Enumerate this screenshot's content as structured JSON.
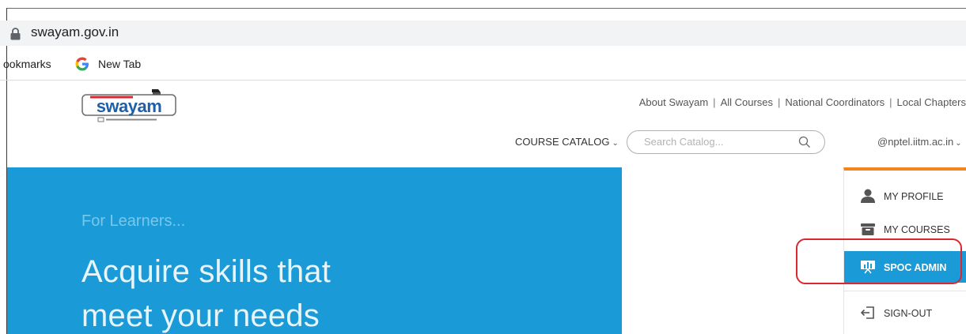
{
  "browser": {
    "url": "swayam.gov.in",
    "bookmarks": [
      {
        "label": "ookmarks"
      },
      {
        "label": "New Tab",
        "icon": "google-icon"
      }
    ]
  },
  "site": {
    "logo_alt": "swayam",
    "top_links": [
      {
        "label": "About Swayam"
      },
      {
        "label": "All Courses"
      },
      {
        "label": "National Coordinators"
      },
      {
        "label": "Local Chapters"
      }
    ],
    "course_catalog_label": "COURSE CATALOG",
    "search_placeholder": "Search Catalog...",
    "user_label": "@nptel.iitm.ac.in"
  },
  "hero": {
    "subtitle": "For Learners...",
    "title_line1": "Acquire skills that",
    "title_line2": "meet your needs"
  },
  "user_dropdown": {
    "items": [
      {
        "label": "MY PROFILE",
        "icon": "user-icon"
      },
      {
        "label": "MY COURSES",
        "icon": "courses-box-icon"
      },
      {
        "label": "SPOC ADMIN",
        "icon": "presentation-icon",
        "active": true
      },
      {
        "label": "SIGN-OUT",
        "icon": "sign-out-icon"
      }
    ]
  },
  "colors": {
    "brand_blue": "#1a9ad6",
    "accent_orange": "#f5841f",
    "highlight_red": "#d9282f"
  }
}
